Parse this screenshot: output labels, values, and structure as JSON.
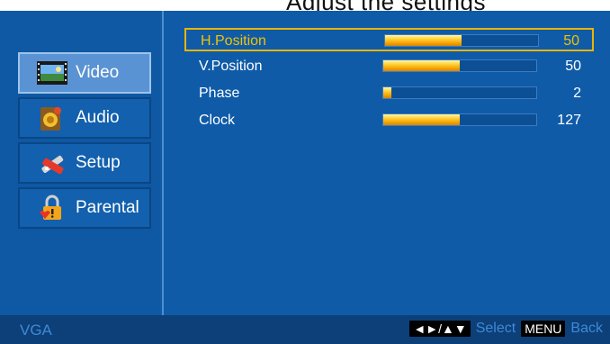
{
  "sidebar": {
    "items": [
      {
        "label": "Video",
        "icon": "film-icon",
        "active": true
      },
      {
        "label": "Audio",
        "icon": "speaker-icon",
        "active": false
      },
      {
        "label": "Setup",
        "icon": "tools-icon",
        "active": false
      },
      {
        "label": "Parental",
        "icon": "lock-icon",
        "active": false
      }
    ]
  },
  "settings": [
    {
      "label": "H.Position",
      "value": "50",
      "level": 0.5,
      "selected": true
    },
    {
      "label": "V.Position",
      "value": "50",
      "level": 0.5,
      "selected": false
    },
    {
      "label": "Phase",
      "value": "2",
      "level": 0.05,
      "selected": false
    },
    {
      "label": "Clock",
      "value": "127",
      "level": 0.5,
      "selected": false
    }
  ],
  "footer": {
    "source": "VGA",
    "nav_key": "◄►/▲▼",
    "select_label": "Select",
    "menu_key": "MENU",
    "back_label": "Back"
  },
  "colors": {
    "background": "#0f5ba8",
    "highlight_border": "#e9b400",
    "selected_text": "#f2c200",
    "footer": "#0d3f78"
  }
}
